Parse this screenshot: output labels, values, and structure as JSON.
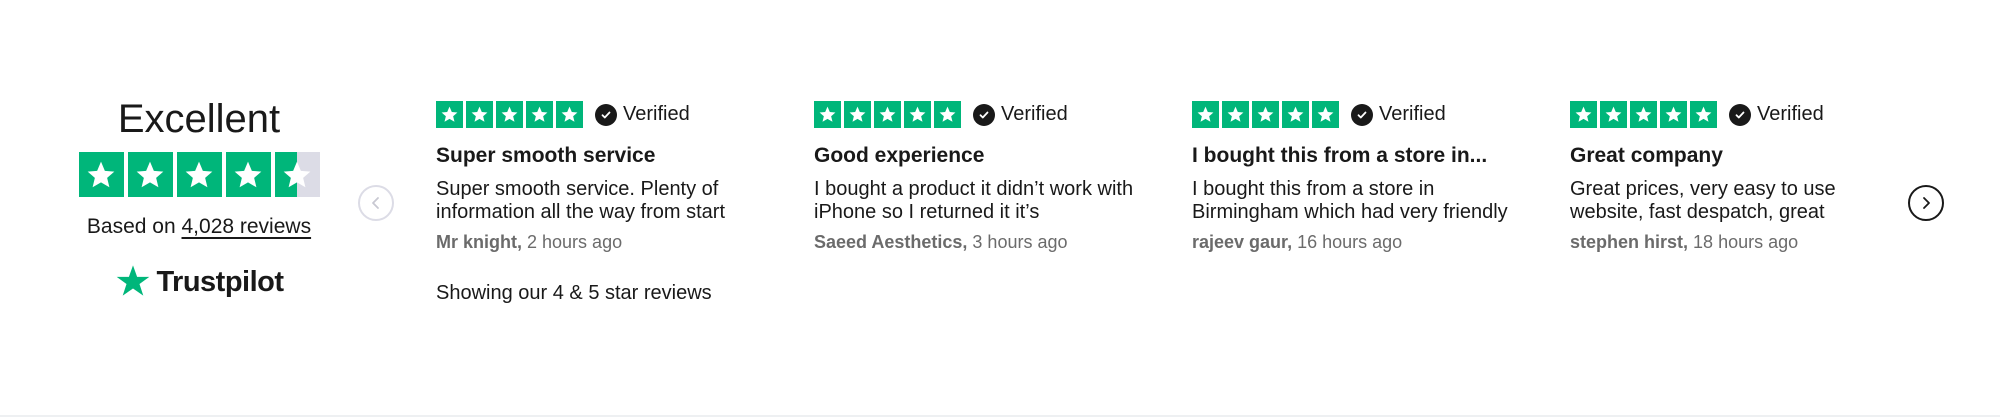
{
  "summary": {
    "rating_label": "Excellent",
    "star_rating": 4.5,
    "based_on_prefix": "Based on",
    "reviews_link": "4,028 reviews",
    "brand": "Trustpilot"
  },
  "colors": {
    "star_green": "#00b67a",
    "star_empty": "#dcdce6",
    "text": "#191919",
    "muted": "#6b6b6b"
  },
  "nav": {
    "prev_icon": "chevron-left-icon",
    "next_icon": "chevron-right-icon"
  },
  "reviews": [
    {
      "stars": 5,
      "verified": "Verified",
      "title": "Super smooth service",
      "body": "Super smooth service. Plenty of information all the way from start",
      "author": "Mr knight,",
      "time": "2 hours ago"
    },
    {
      "stars": 5,
      "verified": "Verified",
      "title": "Good experience",
      "body": "I bought a product it didn’t work with iPhone so I returned it it’s",
      "author": "Saeed Aesthetics,",
      "time": "3 hours ago"
    },
    {
      "stars": 5,
      "verified": "Verified",
      "title": "I bought this from a store in...",
      "body": "I bought this from a store in Birmingham which had very friendly",
      "author": "rajeev gaur,",
      "time": "16 hours ago"
    },
    {
      "stars": 5,
      "verified": "Verified",
      "title": "Great company",
      "body": "Great prices, very easy to use website, fast despatch, great",
      "author": "stephen hirst,",
      "time": "18 hours ago"
    }
  ],
  "showing_text": "Showing our 4 & 5 star reviews"
}
